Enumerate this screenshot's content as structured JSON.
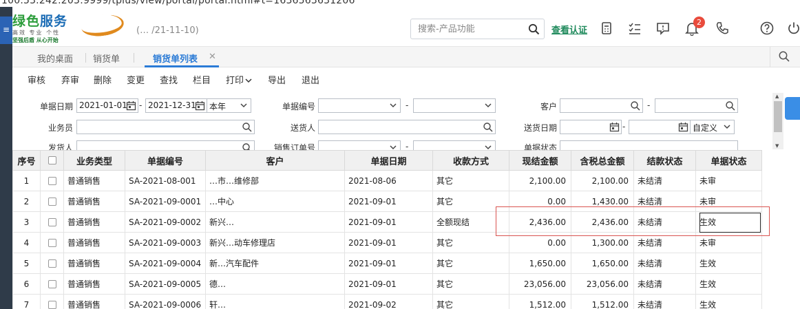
{
  "browser": {
    "url": "100.53.242.203:9999/tplus/view/portal/portal.html#t=1636563631206"
  },
  "header": {
    "logo_main_a": "绿色",
    "logo_main_b": "服务",
    "logo_sub1": "高效 专业 个性",
    "logo_sub2": "坚强后盾 从心开始",
    "company": "(…                    /21-11-10)",
    "search_placeholder": "搜索-产品功能",
    "verify_link": "查看认证",
    "notification_count": "2",
    "icons": [
      "calculator-icon",
      "task-list-icon",
      "message-icon",
      "bell-icon",
      "phone-icon",
      "help-icon",
      "power-icon"
    ]
  },
  "tabs": [
    {
      "label": "我的桌面"
    },
    {
      "label": "销货单"
    },
    {
      "label": "销货单列表",
      "active": true
    }
  ],
  "toolbar": [
    "审核",
    "弃审",
    "删除",
    "变更",
    "查找",
    "栏目",
    "打印",
    "导出",
    "退出"
  ],
  "filters": {
    "date_label": "单据日期",
    "date_from": "2021-01-01",
    "date_to": "2021-12-31",
    "date_range": "本年",
    "docno_label": "单据编号",
    "customer_label": "客户",
    "salesperson_label": "业务员",
    "receiver_label": "送货人",
    "delivery_date_label": "送货日期",
    "delivery_range": "自定义",
    "shipper_label": "发货人",
    "sales_order_label": "销售订单号",
    "doc_status_label": "单据状态",
    "dash": "-"
  },
  "table": {
    "columns": [
      "序号",
      "",
      "业务类型",
      "单据编号",
      "客户",
      "单据日期",
      "收款方式",
      "现结金额",
      "含税总金额",
      "结款状态",
      "单据状态"
    ],
    "rows": [
      [
        "1",
        "",
        "普通销售",
        "SA-2021-08-001",
        "…市…维修部",
        "2021-08-06",
        "其它",
        "2,100.00",
        "2,100.00",
        "未结清",
        "未审"
      ],
      [
        "2",
        "",
        "普通销售",
        "SA-2021-09-0001",
        "…中心",
        "2021-09-01",
        "其它",
        "0.00",
        "1,430.00",
        "未结清",
        "未审"
      ],
      [
        "3",
        "",
        "普通销售",
        "SA-2021-09-0002",
        "新兴…",
        "2021-09-01",
        "全额现结",
        "2,436.00",
        "2,436.00",
        "未结清",
        "生效"
      ],
      [
        "4",
        "",
        "普通销售",
        "SA-2021-09-0003",
        "新兴…动车修理店",
        "2021-09-01",
        "其它",
        "0.00",
        "1,300.00",
        "未结清",
        "未审"
      ],
      [
        "5",
        "",
        "普通销售",
        "SA-2021-09-0004",
        "新…汽车配件",
        "2021-09-01",
        "其它",
        "1,650.00",
        "1,650.00",
        "未结清",
        "生效"
      ],
      [
        "6",
        "",
        "普通销售",
        "SA-2021-09-0005",
        "德…",
        "2021-09-01",
        "其它",
        "23,056.00",
        "23,056.00",
        "未结清",
        "生效"
      ],
      [
        "7",
        "",
        "普通销售",
        "SA-2021-09-0006",
        "轩…",
        "2021-09-02",
        "其它",
        "1,512.00",
        "1,512.00",
        "未结清",
        "生效"
      ]
    ]
  },
  "colors": {
    "accent": "#2b7bd6",
    "highlight": "#d9534f",
    "sidebar": "#2f3b49"
  }
}
